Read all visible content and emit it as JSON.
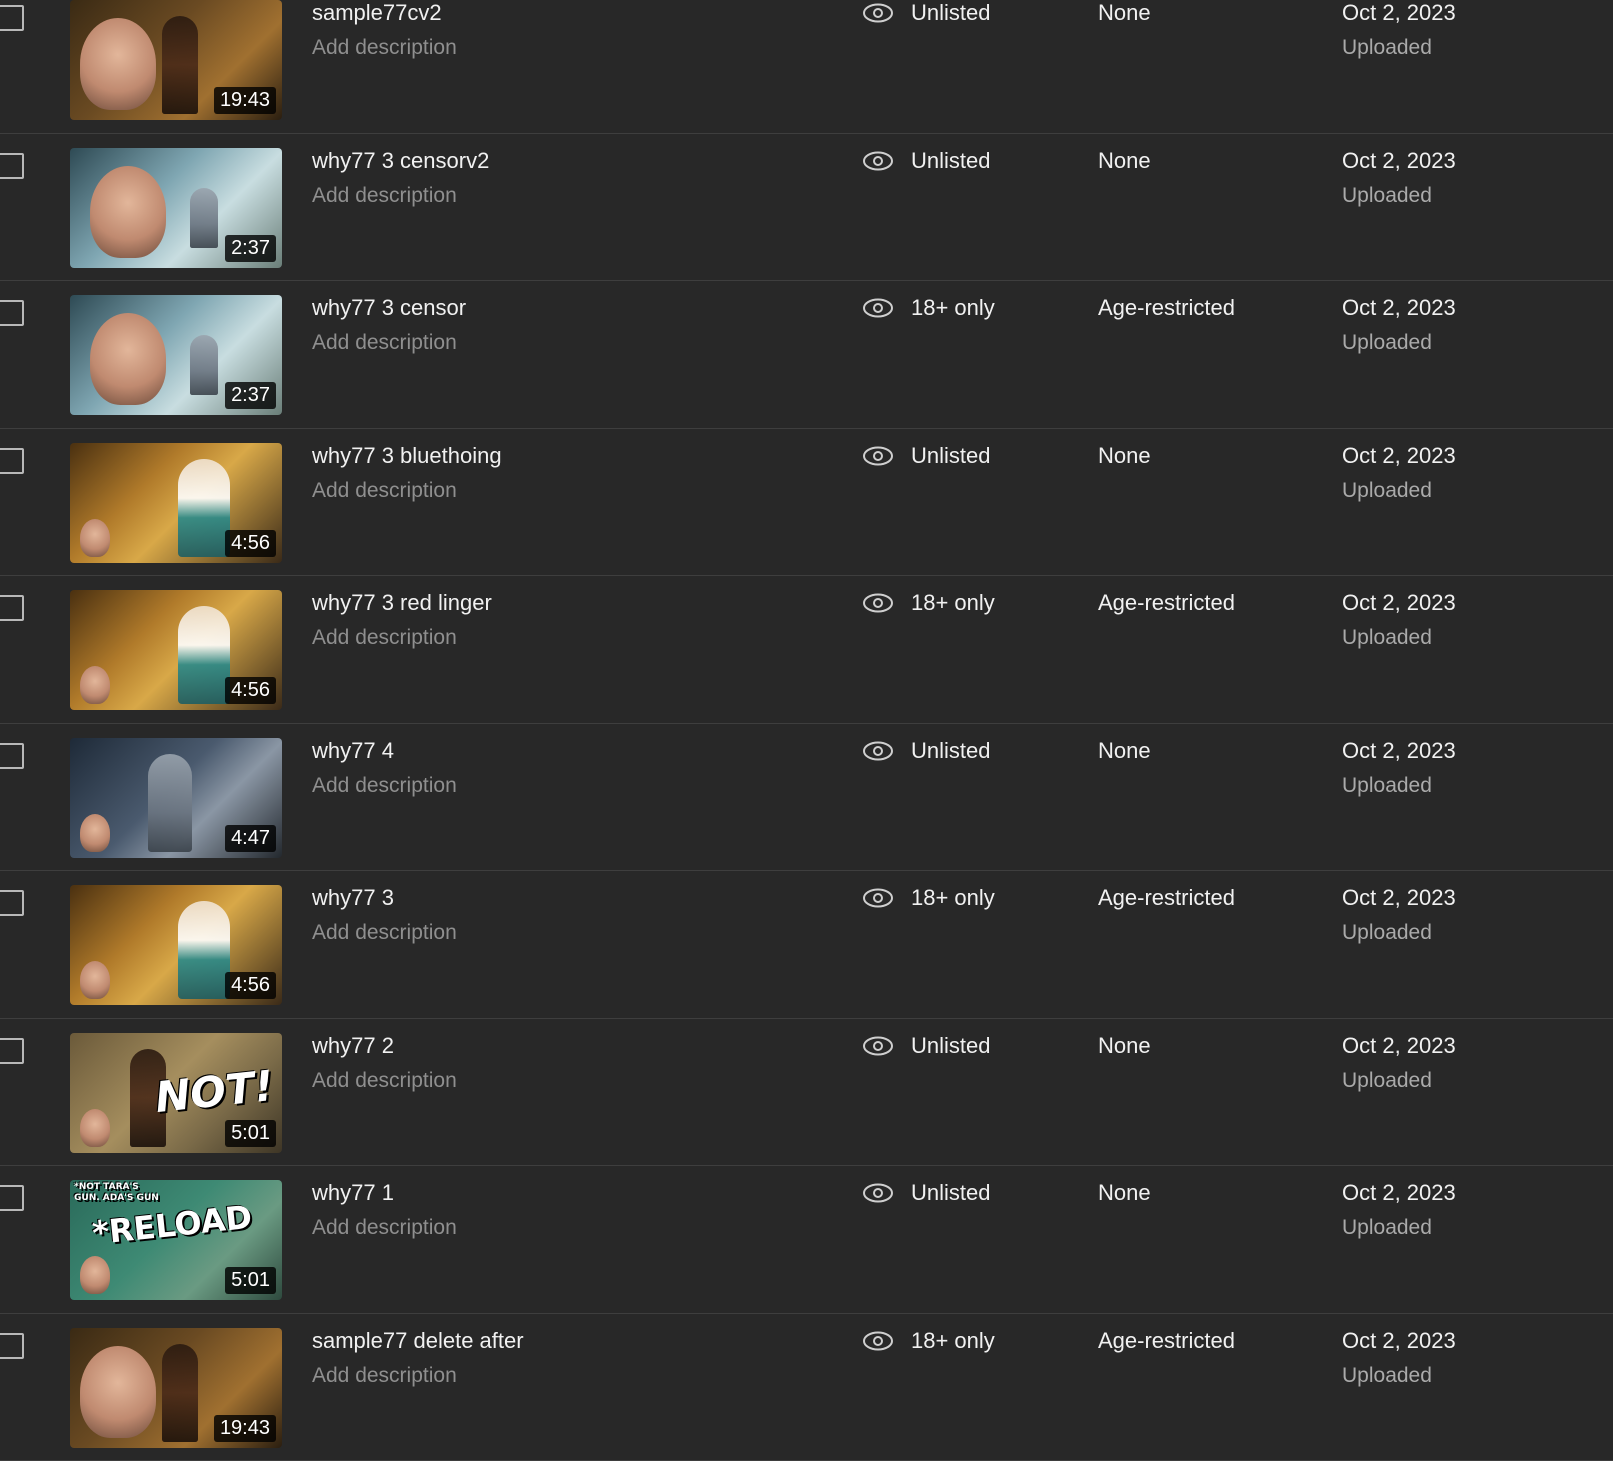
{
  "videos": [
    {
      "title": "sample77cv2",
      "description": "Add description",
      "duration": "19:43",
      "visibility": "Unlisted",
      "restrictions": "None",
      "date": "Oct 2, 2023",
      "date_status": "Uploaded",
      "thumb_style": "dark",
      "overlay": ""
    },
    {
      "title": "why77 3 censorv2",
      "description": "Add description",
      "duration": "2:37",
      "visibility": "Unlisted",
      "restrictions": "None",
      "date": "Oct 2, 2023",
      "date_status": "Uploaded",
      "thumb_style": "fog",
      "overlay": ""
    },
    {
      "title": "why77 3 censor",
      "description": "Add description",
      "duration": "2:37",
      "visibility": "18+ only",
      "restrictions": "Age-restricted",
      "date": "Oct 2, 2023",
      "date_status": "Uploaded",
      "thumb_style": "fog",
      "overlay": ""
    },
    {
      "title": "why77 3 bluethoing",
      "description": "Add description",
      "duration": "4:56",
      "visibility": "Unlisted",
      "restrictions": "None",
      "date": "Oct 2, 2023",
      "date_status": "Uploaded",
      "thumb_style": "warm",
      "overlay": ""
    },
    {
      "title": "why77 3 red linger",
      "description": "Add description",
      "duration": "4:56",
      "visibility": "18+ only",
      "restrictions": "Age-restricted",
      "date": "Oct 2, 2023",
      "date_status": "Uploaded",
      "thumb_style": "warm",
      "overlay": ""
    },
    {
      "title": "why77 4",
      "description": "Add description",
      "duration": "4:47",
      "visibility": "Unlisted",
      "restrictions": "None",
      "date": "Oct 2, 2023",
      "date_status": "Uploaded",
      "thumb_style": "steel",
      "overlay": ""
    },
    {
      "title": "why77 3",
      "description": "Add description",
      "duration": "4:56",
      "visibility": "18+ only",
      "restrictions": "Age-restricted",
      "date": "Oct 2, 2023",
      "date_status": "Uploaded",
      "thumb_style": "warm",
      "overlay": ""
    },
    {
      "title": "why77 2",
      "description": "Add description",
      "duration": "5:01",
      "visibility": "Unlisted",
      "restrictions": "None",
      "date": "Oct 2, 2023",
      "date_status": "Uploaded",
      "thumb_style": "sepia",
      "overlay": "NOT!"
    },
    {
      "title": "why77 1",
      "description": "Add description",
      "duration": "5:01",
      "visibility": "Unlisted",
      "restrictions": "None",
      "date": "Oct 2, 2023",
      "date_status": "Uploaded",
      "thumb_style": "teal",
      "overlay": "*RELOAD",
      "overlay_small": "*NOT TARA'S GUN. ADA'S GUN"
    },
    {
      "title": "sample77 delete after",
      "description": "Add description",
      "duration": "19:43",
      "visibility": "18+ only",
      "restrictions": "Age-restricted",
      "date": "Oct 2, 2023",
      "date_status": "Uploaded",
      "thumb_style": "dark",
      "overlay": ""
    }
  ],
  "icons": {
    "visibility": "eye-icon"
  },
  "colors": {
    "background": "#282828",
    "text_primary": "#f1f1f1",
    "text_secondary": "#aaaaaa",
    "divider": "#3e3e3e"
  }
}
